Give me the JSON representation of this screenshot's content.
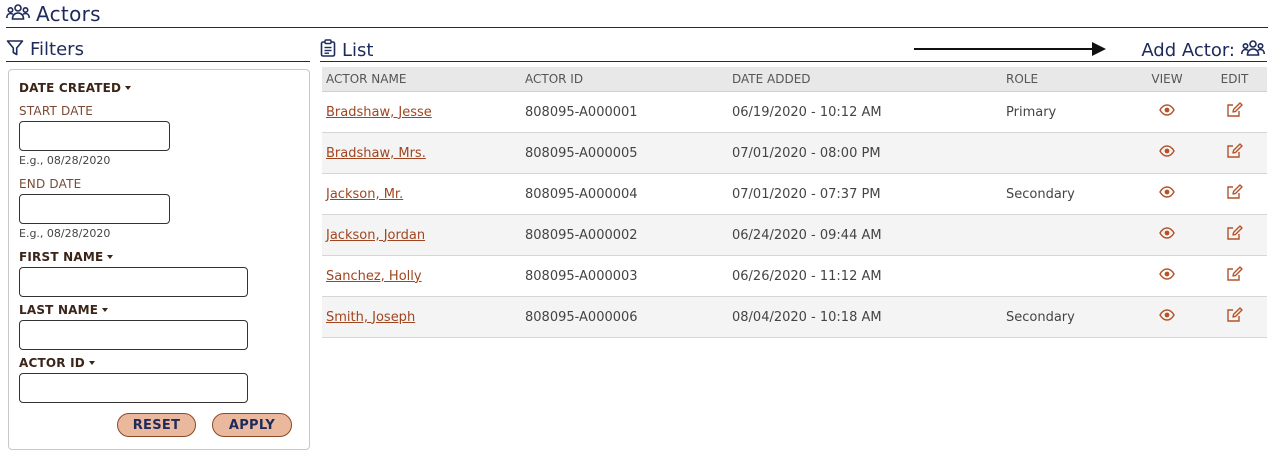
{
  "page": {
    "title": "Actors",
    "icon": "people-icon"
  },
  "filters": {
    "title": "Filters",
    "icon": "filter-icon",
    "date_created_label": "DATE CREATED",
    "start_date_label": "START DATE",
    "start_date_value": "",
    "start_date_hint": "E.g., 08/28/2020",
    "end_date_label": "END DATE",
    "end_date_value": "",
    "end_date_hint": "E.g., 08/28/2020",
    "first_name_label": "FIRST NAME",
    "first_name_value": "",
    "last_name_label": "LAST NAME",
    "last_name_value": "",
    "actor_id_label": "ACTOR ID",
    "actor_id_value": "",
    "reset_label": "RESET",
    "apply_label": "APPLY"
  },
  "list": {
    "title": "List",
    "icon": "clipboard-icon",
    "add_actor_label": "Add Actor:",
    "add_actor_icon": "people-icon",
    "columns": [
      "ACTOR NAME",
      "ACTOR ID",
      "DATE ADDED",
      "ROLE",
      "VIEW",
      "EDIT"
    ],
    "rows": [
      {
        "name": "Bradshaw, Jesse",
        "actor_id": "808095-A000001",
        "date_added": "06/19/2020 - 10:12 AM",
        "role": "Primary"
      },
      {
        "name": "Bradshaw, Mrs.",
        "actor_id": "808095-A000005",
        "date_added": "07/01/2020 - 08:00 PM",
        "role": ""
      },
      {
        "name": "Jackson, Mr.",
        "actor_id": "808095-A000004",
        "date_added": "07/01/2020 - 07:37 PM",
        "role": "Secondary"
      },
      {
        "name": "Jackson, Jordan",
        "actor_id": "808095-A000002",
        "date_added": "06/24/2020 - 09:44 AM",
        "role": ""
      },
      {
        "name": "Sanchez, Holly",
        "actor_id": "808095-A000003",
        "date_added": "06/26/2020 - 11:12 AM",
        "role": ""
      },
      {
        "name": "Smith, Joseph",
        "actor_id": "808095-A000006",
        "date_added": "08/04/2020 - 10:18 AM",
        "role": "Secondary"
      }
    ]
  },
  "colors": {
    "navy": "#1e2a5a",
    "rust": "#b4532a",
    "button_fill": "#eab99d",
    "header_row_bg": "#e8e8e8"
  }
}
